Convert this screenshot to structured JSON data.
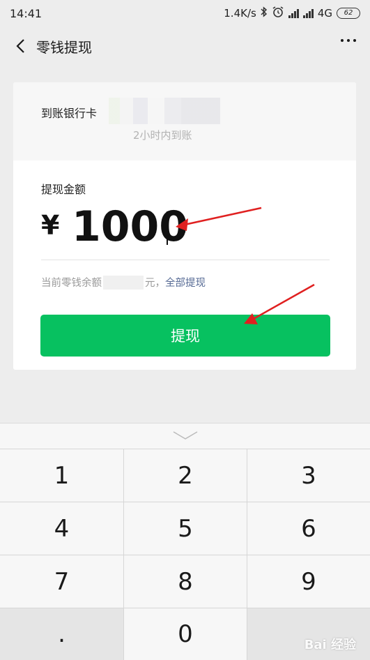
{
  "status_bar": {
    "time": "14:41",
    "net_speed": "1.4K/s",
    "network": "4G",
    "battery": "62",
    "icons": [
      "bluetooth-icon",
      "alarm-icon",
      "signal-icon",
      "signal-icon",
      "battery-icon"
    ]
  },
  "nav": {
    "title": "零钱提现",
    "back_icon": "chevron-left-icon",
    "more_icon": "more-icon"
  },
  "bank": {
    "label": "到账银行卡",
    "arrival_note": "2小时内到账"
  },
  "amount": {
    "label": "提现金额",
    "currency": "¥",
    "value": "1000"
  },
  "balance": {
    "prefix": "当前零钱余额",
    "suffix": "元，",
    "withdraw_all": "全部提现"
  },
  "withdraw_button": "提现",
  "keypad": {
    "collapse_icon": "chevron-down-icon",
    "keys": [
      "1",
      "2",
      "3",
      "4",
      "5",
      "6",
      "7",
      "8",
      "9",
      ".",
      "0",
      ""
    ]
  },
  "watermark": "Bai 经验",
  "colors": {
    "accent_green": "#07c160",
    "link_blue": "#576b95",
    "annotation_red": "#e02020"
  }
}
